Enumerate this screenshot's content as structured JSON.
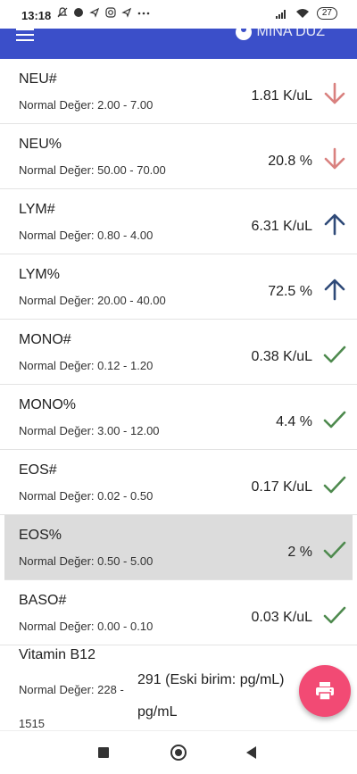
{
  "status": {
    "time": "13:18",
    "battery": "27"
  },
  "header": {
    "user_name": "MİNA DÜZ"
  },
  "results": [
    {
      "name": "NEU#",
      "normal": "Normal Değer: 2.00 - 7.00",
      "value": "1.81 K/uL",
      "trend": "down"
    },
    {
      "name": "NEU%",
      "normal": "Normal Değer: 50.00 - 70.00",
      "value": "20.8 %",
      "trend": "down"
    },
    {
      "name": "LYM#",
      "normal": "Normal Değer: 0.80 - 4.00",
      "value": "6.31 K/uL",
      "trend": "up"
    },
    {
      "name": "LYM%",
      "normal": "Normal Değer: 20.00 - 40.00",
      "value": "72.5 %",
      "trend": "up"
    },
    {
      "name": "MONO#",
      "normal": "Normal Değer: 0.12 - 1.20",
      "value": "0.38 K/uL",
      "trend": "normal"
    },
    {
      "name": "MONO%",
      "normal": "Normal Değer: 3.00 - 12.00",
      "value": "4.4 %",
      "trend": "normal"
    },
    {
      "name": "EOS#",
      "normal": "Normal Değer: 0.02 - 0.50",
      "value": "0.17 K/uL",
      "trend": "normal"
    },
    {
      "name": "EOS%",
      "normal": "Normal Değer: 0.50 - 5.00",
      "value": "2 %",
      "trend": "normal"
    },
    {
      "name": "BASO#",
      "normal": "Normal Değer: 0.00 - 0.10",
      "value": "0.03 K/uL",
      "trend": "normal"
    },
    {
      "name": "Vitamin B12",
      "normal": "Normal Değer: 228 - 1515",
      "value": "291 (Eski birim: pg/mL) pg/mL",
      "trend": ""
    }
  ],
  "colors": {
    "appbar": "#3b4fc9",
    "down": "#d9817f",
    "up": "#2f4a78",
    "normal": "#4e8a4e",
    "fab": "#f24a74"
  },
  "icons": {
    "down": "arrow-down-icon",
    "up": "arrow-up-icon",
    "normal": "check-icon",
    "fab": "print-icon"
  }
}
